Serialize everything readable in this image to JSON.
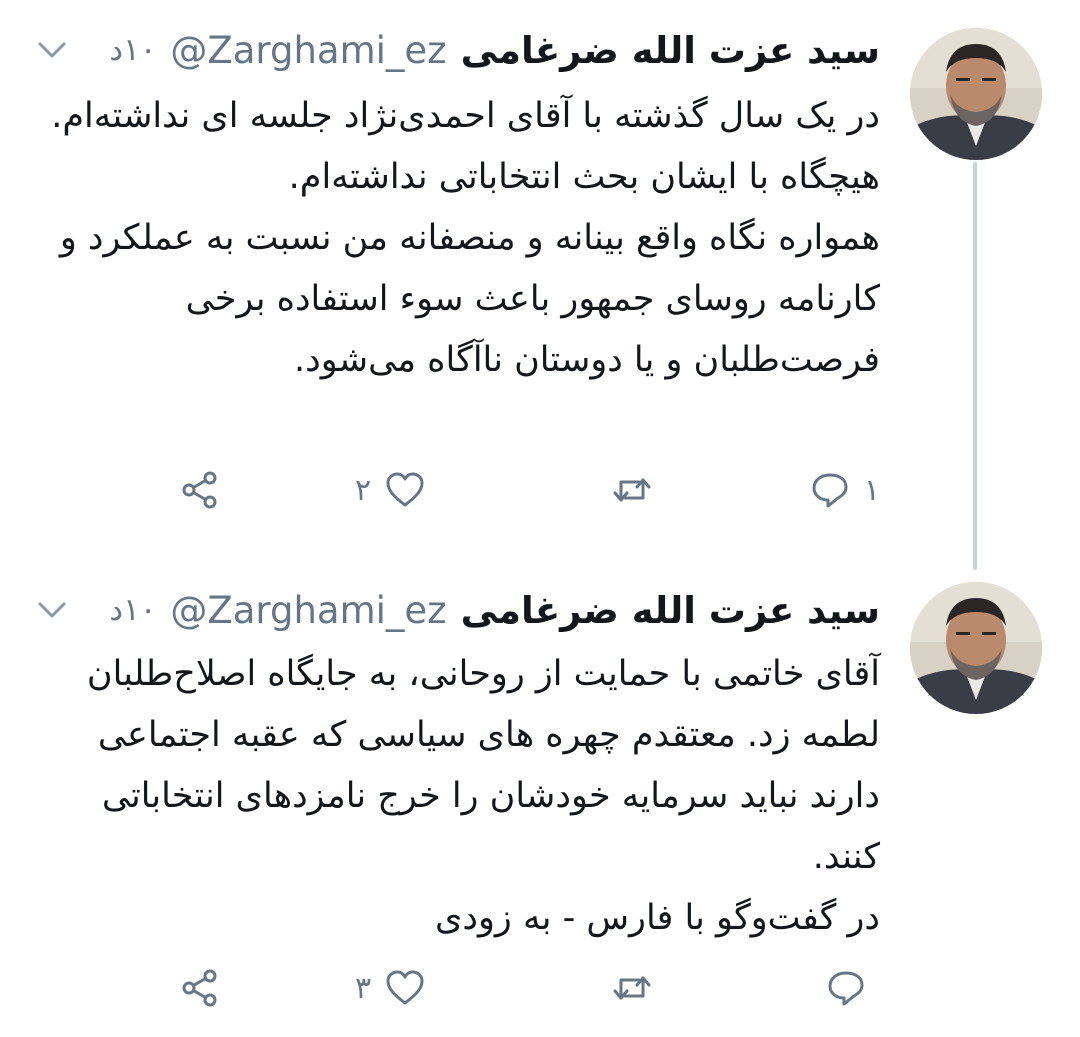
{
  "tweets": [
    {
      "author": {
        "display_name": "سید عزت الله ضرغامی",
        "handle": "@Zarghami_ez",
        "avatar_icon": "profile-photo"
      },
      "time": "۱۰د",
      "paragraphs": [
        "در یک سال گذشته با آقای احمدی‌نژاد جلسه ای نداشته‌ام.",
        "هیچگاه با ایشان بحث انتخاباتی نداشته‌ام.",
        "همواره نگاه واقع بینانه و منصفانه من نسبت به عملکرد و کارنامه روسای جمهور باعث سوء استفاده برخی فرصت‌طلبان و یا دوستان ناآگاه می‌شود."
      ],
      "actions": {
        "reply_count": "۱",
        "retweet_count": "",
        "like_count": "۲"
      }
    },
    {
      "author": {
        "display_name": "سید عزت الله ضرغامی",
        "handle": "@Zarghami_ez",
        "avatar_icon": "profile-photo"
      },
      "time": "۱۰د",
      "paragraphs": [
        "آقای خاتمی با حمایت از روحانی، به جایگاه اصلاح‌طلبان لطمه زد. معتقدم چهره های سیاسی که عقبه اجتماعی دارند نباید سرمایه خودشان را خرج نامزدهای انتخاباتی کنند.",
        "در گفت‌وگو با فارس - به زودی"
      ],
      "actions": {
        "reply_count": "",
        "retweet_count": "",
        "like_count": "۳"
      }
    }
  ],
  "colors": {
    "text": "#14171a",
    "secondary": "#657786",
    "thread_line": "#c9d3da",
    "background": "#ffffff"
  }
}
